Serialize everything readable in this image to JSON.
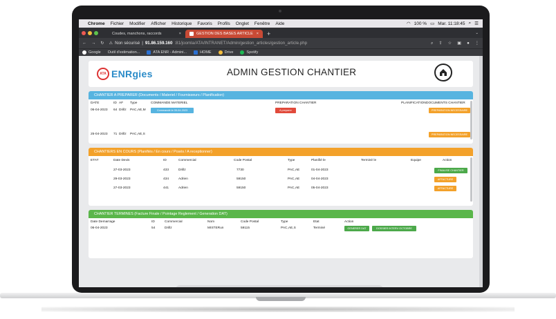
{
  "menubar": {
    "items": [
      "Chrome",
      "Fichier",
      "Modifier",
      "Afficher",
      "Historique",
      "Favoris",
      "Profils",
      "Onglet",
      "Fenêtre",
      "Aide"
    ],
    "battery": "100 %",
    "clock": "Mar. 11:18:45"
  },
  "tabs": [
    {
      "label": "Coudes, manchons, raccords"
    },
    {
      "label": "GESTION DES BASES ARTICLE"
    }
  ],
  "address": {
    "security": "Non sécurisé",
    "host": "91.86.159.160",
    "path": ":81/joomla/ATA/INTRANET/Admin/gestion_articles/gestion_article.php"
  },
  "bookmarks": [
    "Google",
    "Outil d'estimation...",
    "ATA ENR - Admini...",
    "HOME",
    "Drive",
    "Spotify"
  ],
  "header": {
    "logo_prefix": "ENRgies",
    "logo_badge": "ATA",
    "title": "ADMIN GESTION CHANTIER"
  },
  "panel_prepare": {
    "title": "CHANTIER A PREPARER (Documents / Materiel / Fournisseurs / Planification)",
    "headers": {
      "date": "DATE",
      "id": "ID",
      "af": "AF",
      "type": "Type",
      "commande": "COMMANDE MATERIEL",
      "preparation": "PREPARATION CHANTIER",
      "planification": "PLANIFICATION",
      "documents": "DOCUMENTS CHANTIER"
    },
    "rows": [
      {
        "date": "06-04-2023",
        "id": "64",
        "af": "Drillz",
        "type": "PAC,AE,M",
        "commande": "Commandé le 05-04-2023",
        "preparation": "A preparer",
        "documents": "PREPARATION NECESSAIRE"
      },
      {
        "date": "25-04-2023",
        "id": "71",
        "af": "Drillz",
        "type": "PAC,AE,S",
        "commande": "",
        "preparation": "",
        "documents": "PREPARATION NECESSAIRE"
      }
    ]
  },
  "panel_encours": {
    "title": "CHANTIERS EN COURS (Planifiés / En cours / Posés / A receptionner)",
    "headers": {
      "etat": "ETAT",
      "date_devis": "Date Devis",
      "id": "ID",
      "commercial": "Commercial",
      "cp": "Code Postal",
      "type": "Type",
      "planifie": "Planifié le",
      "termine": "Terminé le",
      "equipe": "Equipe",
      "action": "Action"
    },
    "rows": [
      {
        "date": "27-03-2023",
        "id": "433",
        "commercial": "Drillz",
        "cp": "7730",
        "type": "PAC,AE",
        "planifie": "01-04-2023",
        "action": "FINALISE CHANTIER",
        "color": "green"
      },
      {
        "date": "29-03-2023",
        "id": "434",
        "commercial": "Adrien",
        "cp": "59150",
        "type": "PAC,AE",
        "planifie": "04-04-2023",
        "action": "AFFACTURE",
        "color": "orange"
      },
      {
        "date": "27-03-2023",
        "id": "441",
        "commercial": "Adrien",
        "cp": "59150",
        "type": "PAC,AE",
        "planifie": "05-04-2023",
        "action": "AFFACTURE",
        "color": "orange"
      }
    ]
  },
  "panel_termines": {
    "title": "CHANTIER TERMINES (Facture Finale / Pointage Reglement / Generation DAT)",
    "headers": {
      "date": "Date Demarrage",
      "id": "ID",
      "commercial": "Commercial",
      "nom": "Nom",
      "cp": "Code Postal",
      "type": "Type",
      "etat": "Etat",
      "action": "Action"
    },
    "rows": [
      {
        "date": "06-04-2023",
        "id": "54",
        "commercial": "Drillz",
        "nom": "MISTERun",
        "cp": "59115",
        "type": "PAC,AE,S",
        "etat": "Terminé",
        "action1": "GENERER DAT",
        "action2": "DOSSIER INTERV OCTOBRE"
      }
    ]
  },
  "colors": {
    "blue": "#57b4e0",
    "orange": "#f3a12a",
    "green": "#5ab64a",
    "red": "#e14a3b"
  }
}
